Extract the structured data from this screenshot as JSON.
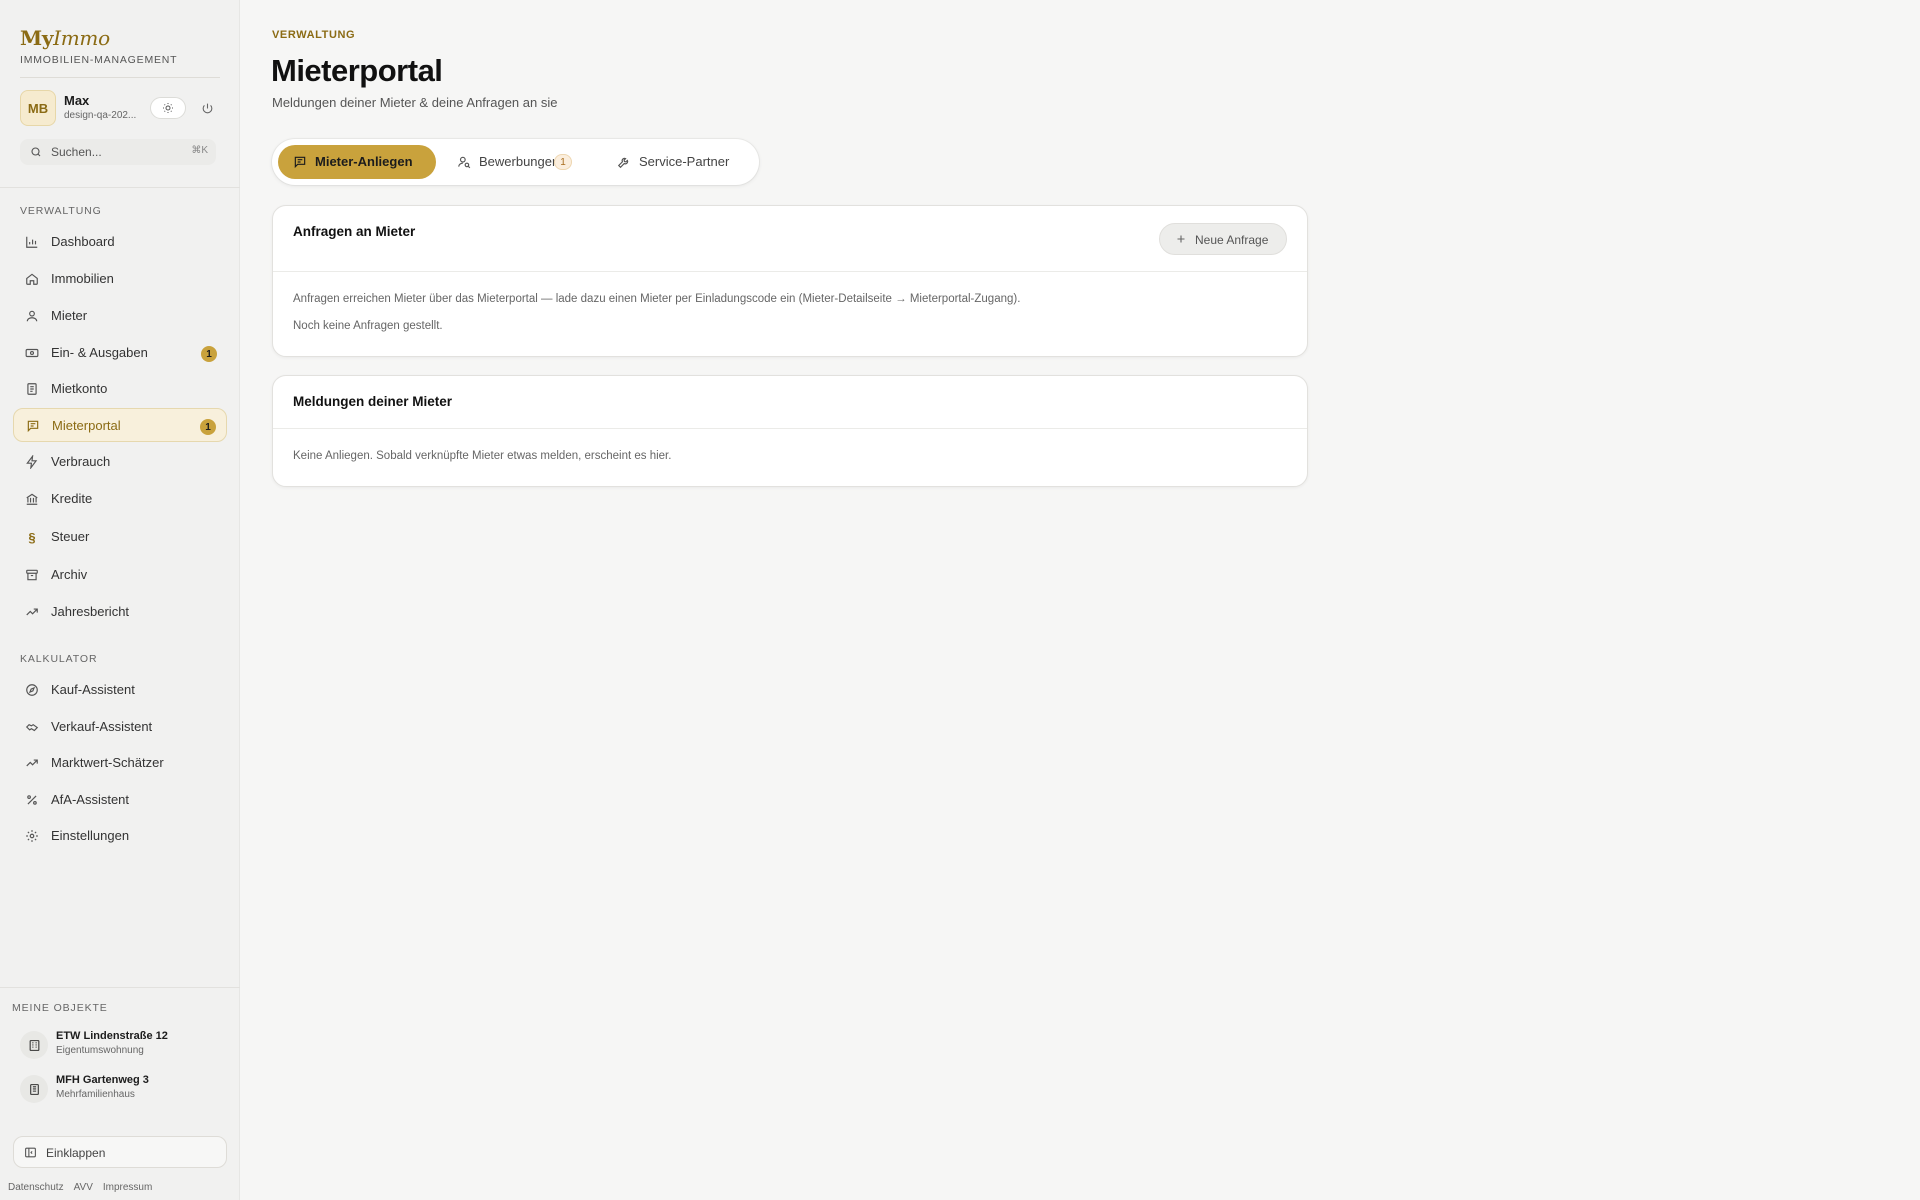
{
  "brand": {
    "logo_part1": "My",
    "logo_part2": "Immo",
    "subtitle": "IMMOBILIEN-MANAGEMENT"
  },
  "user": {
    "initials": "MB",
    "name": "Max",
    "email": "design-qa-202..."
  },
  "search": {
    "placeholder": "Suchen...",
    "shortcut": "⌘K"
  },
  "nav": {
    "section_verwaltung": "VERWALTUNG",
    "items": [
      {
        "label": "Dashboard",
        "icon": "bar-chart-icon"
      },
      {
        "label": "Immobilien",
        "icon": "home-icon"
      },
      {
        "label": "Mieter",
        "icon": "user-icon"
      },
      {
        "label": "Ein- & Ausgaben",
        "icon": "cash-icon",
        "badge": "1"
      },
      {
        "label": "Mietkonto",
        "icon": "ledger-icon"
      },
      {
        "label": "Mieterportal",
        "icon": "message-icon",
        "badge": "1",
        "active": true
      },
      {
        "label": "Verbrauch",
        "icon": "bolt-icon"
      },
      {
        "label": "Kredite",
        "icon": "bank-icon"
      },
      {
        "label": "Steuer",
        "icon": "paragraph-icon"
      },
      {
        "label": "Archiv",
        "icon": "archive-icon"
      },
      {
        "label": "Jahresbericht",
        "icon": "trend-icon"
      }
    ],
    "section_kalkulator": "KALKULATOR",
    "calc_items": [
      {
        "label": "Kauf-Assistent",
        "icon": "compass-icon"
      },
      {
        "label": "Verkauf-Assistent",
        "icon": "handshake-icon"
      },
      {
        "label": "Marktwert-Schätzer",
        "icon": "trend-icon"
      },
      {
        "label": "AfA-Assistent",
        "icon": "percent-icon"
      },
      {
        "label": "Einstellungen",
        "icon": "gear-icon"
      }
    ]
  },
  "objects": {
    "section_label": "MEINE OBJEKTE",
    "items": [
      {
        "title": "ETW Lindenstraße 12",
        "subtitle": "Eigentumswohnung"
      },
      {
        "title": "MFH Gartenweg 3",
        "subtitle": "Mehrfamilienhaus"
      }
    ]
  },
  "collapse_label": "Einklappen",
  "footer": {
    "privacy": "Datenschutz",
    "avv": "AVV",
    "imprint": "Impressum"
  },
  "main": {
    "eyebrow": "VERWALTUNG",
    "title": "Mieterportal",
    "subtitle": "Meldungen deiner Mieter & deine Anfragen an sie",
    "tabs": [
      {
        "label": "Mieter-Anliegen",
        "active": true
      },
      {
        "label": "Bewerbungen",
        "badge": "1"
      },
      {
        "label": "Service-Partner"
      }
    ],
    "card_requests": {
      "title": "Anfragen an Mieter",
      "button": "Neue Anfrage",
      "info": "Anfragen erreichen Mieter über das Mieterportal — lade dazu einen Mieter per Einladungscode ein (Mieter-Detailseite → Mieterportal-Zugang).",
      "empty": "Noch keine Anfragen gestellt."
    },
    "card_reports": {
      "title": "Meldungen deiner Mieter",
      "empty": "Keine Anliegen. Sobald verknüpfte Mieter etwas melden, erscheint es hier."
    }
  },
  "colors": {
    "accent": "#c9a23c",
    "accent_text": "#8b6b14",
    "background": "#f6f6f5"
  }
}
